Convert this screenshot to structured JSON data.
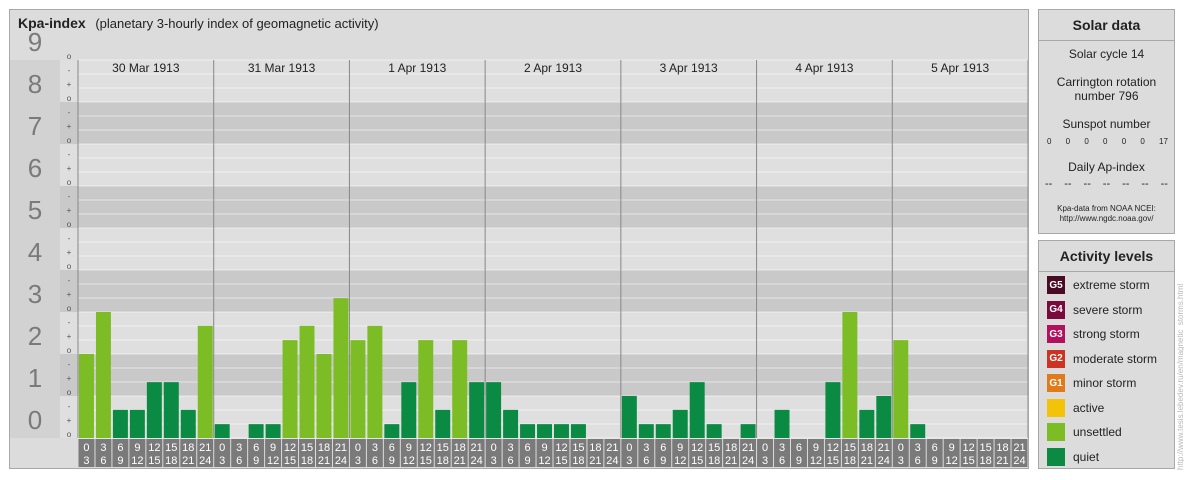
{
  "title": "Kpa-index",
  "subtitle": "(planetary 3-hourly index of geomagnetic activity)",
  "chart_data": {
    "type": "bar",
    "ylim": [
      0,
      9
    ],
    "y_major_ticks": [
      "0",
      "1",
      "2",
      "3",
      "4",
      "5",
      "6",
      "7",
      "8",
      "9"
    ],
    "y_minor_labels": [
      "o",
      "+",
      "-",
      "o"
    ],
    "days": [
      "30 Mar 1913",
      "31 Mar 1913",
      "1 Apr 1913",
      "2 Apr 1913",
      "3 Apr 1913",
      "4 Apr 1913",
      "5 Apr 1913"
    ],
    "interval_starts": [
      "0",
      "3",
      "6",
      "9",
      "12",
      "15",
      "18",
      "21"
    ],
    "interval_ends": [
      "3",
      "6",
      "9",
      "12",
      "15",
      "18",
      "21",
      "24"
    ],
    "values": [
      [
        2.0,
        3.0,
        0.67,
        0.67,
        1.33,
        1.33,
        0.67,
        2.67
      ],
      [
        0.33,
        0,
        0.33,
        0.33,
        2.33,
        2.67,
        2.0,
        3.33
      ],
      [
        2.33,
        2.67,
        0.33,
        1.33,
        2.33,
        0.67,
        2.33,
        1.33
      ],
      [
        1.33,
        0.67,
        0.33,
        0.33,
        0.33,
        0.33,
        0,
        0
      ],
      [
        1.0,
        0.33,
        0.33,
        0.67,
        1.33,
        0.33,
        0,
        0.33
      ],
      [
        0,
        0.67,
        0,
        0,
        1.33,
        3.0,
        0.67,
        1.0
      ],
      [
        2.33,
        0.33,
        0,
        0,
        0,
        0,
        0,
        0
      ]
    ],
    "colors": {
      "quiet": "#0b8a43",
      "unsettled": "#7cbd26"
    }
  },
  "solar": {
    "heading": "Solar data",
    "cycle": "Solar cycle 14",
    "carrington_1": "Carrington rotation",
    "carrington_2": "number 796",
    "sunspot_label": "Sunspot number",
    "sunspot_values": [
      "0",
      "0",
      "0",
      "0",
      "0",
      "0",
      "17"
    ],
    "ap_label": "Daily Ap-index",
    "ap_values": [
      "--",
      "--",
      "--",
      "--",
      "--",
      "--",
      "--"
    ],
    "credit_1": "Kpa-data from NOAA NCEI:",
    "credit_2": "http://www.ngdc.noaa.gov/"
  },
  "activity": {
    "heading": "Activity levels",
    "levels": [
      {
        "code": "G5",
        "label": "extreme storm",
        "color": "#4a0a24"
      },
      {
        "code": "G4",
        "label": "severe storm",
        "color": "#7a0a3c"
      },
      {
        "code": "G3",
        "label": "strong storm",
        "color": "#b3115e"
      },
      {
        "code": "G2",
        "label": "moderate storm",
        "color": "#cc3320"
      },
      {
        "code": "G1",
        "label": "minor storm",
        "color": "#e07a1b"
      },
      {
        "code": "",
        "label": "active",
        "color": "#f5c20a"
      },
      {
        "code": "",
        "label": "unsettled",
        "color": "#7cbd26"
      },
      {
        "code": "",
        "label": "quiet",
        "color": "#0b8a43"
      }
    ]
  },
  "watermark": "http://www.tesis.lebedev.ru/en/magnetic_storms.html"
}
